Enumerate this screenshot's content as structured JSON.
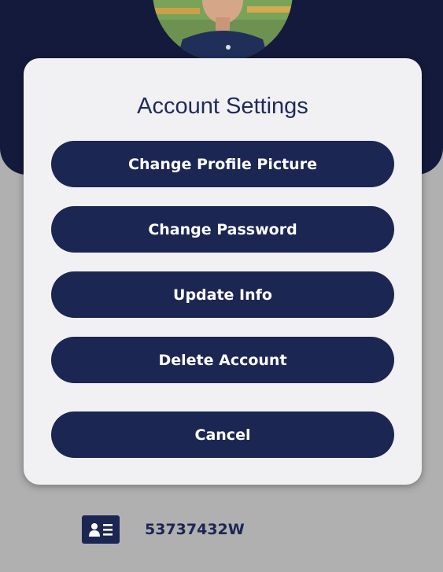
{
  "modal": {
    "title": "Account Settings",
    "buttons": [
      {
        "label": "Change Profile Picture"
      },
      {
        "label": "Change Password"
      },
      {
        "label": "Update Info"
      },
      {
        "label": "Delete Account"
      },
      {
        "label": "Cancel"
      }
    ]
  },
  "profile": {
    "avatar_icon": "profile-photo",
    "id_icon": "id-card-icon",
    "id_number": "53737432W"
  },
  "colors": {
    "header": "#141a3c",
    "button": "#1c2653",
    "modal": "#f1f1f3",
    "backdrop": "#b0b0b0"
  }
}
